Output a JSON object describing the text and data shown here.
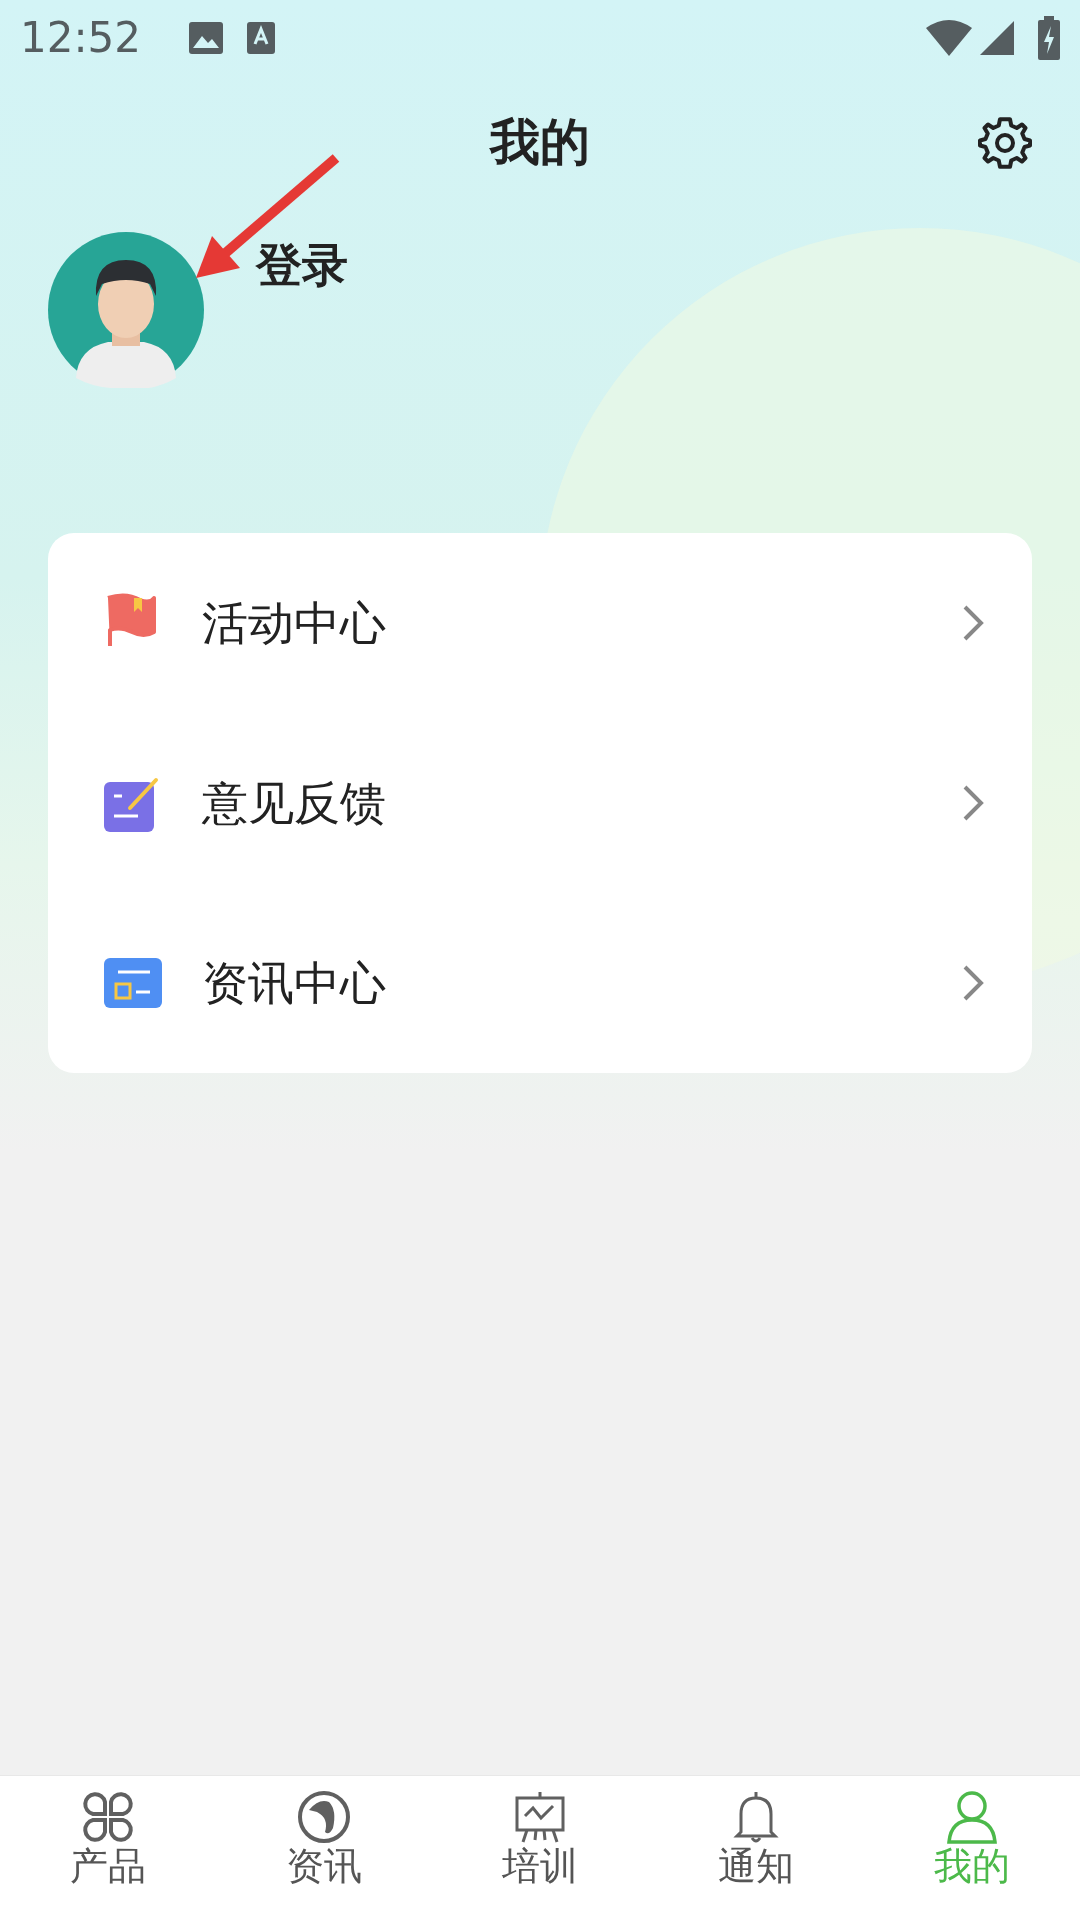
{
  "status_bar": {
    "time": "12:52"
  },
  "header": {
    "title": "我的"
  },
  "profile": {
    "login_label": "登录"
  },
  "menu": [
    {
      "kind": "activity",
      "label": "活动中心"
    },
    {
      "kind": "feedback",
      "label": "意见反馈"
    },
    {
      "kind": "news",
      "label": "资讯中心"
    }
  ],
  "bottom_nav": [
    {
      "kind": "products",
      "label": "产品",
      "selected": false
    },
    {
      "kind": "news",
      "label": "资讯",
      "selected": false
    },
    {
      "kind": "training",
      "label": "培训",
      "selected": false
    },
    {
      "kind": "notify",
      "label": "通知",
      "selected": false
    },
    {
      "kind": "mine",
      "label": "我的",
      "selected": true
    }
  ]
}
